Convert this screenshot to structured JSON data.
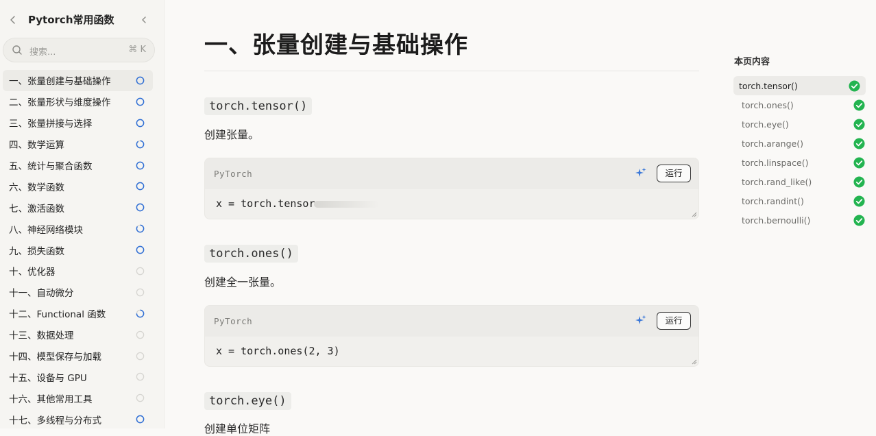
{
  "sidebar": {
    "title": "Pytorch常用函数",
    "search_placeholder": "搜索...",
    "search_shortcut": "⌘ K",
    "items": [
      {
        "label": "一、张量创建与基础操作",
        "progress": 1.0,
        "active": true
      },
      {
        "label": "二、张量形状与维度操作",
        "progress": 1.0
      },
      {
        "label": "三、张量拼接与选择",
        "progress": 1.0
      },
      {
        "label": "四、数学运算",
        "progress": 0.9
      },
      {
        "label": "五、统计与聚合函数",
        "progress": 1.0
      },
      {
        "label": "六、数学函数",
        "progress": 1.0
      },
      {
        "label": "七、激活函数",
        "progress": 1.0
      },
      {
        "label": "八、神经网络模块",
        "progress": 0.85
      },
      {
        "label": "九、损失函数",
        "progress": 1.0
      },
      {
        "label": "十、优化器",
        "progress": 0
      },
      {
        "label": "十一、自动微分",
        "progress": 0
      },
      {
        "label": "十二、Functional 函数",
        "progress": 0.75
      },
      {
        "label": "十三、数据处理",
        "progress": 0
      },
      {
        "label": "十四、模型保存与加载",
        "progress": 0
      },
      {
        "label": "十五、设备与 GPU",
        "progress": 0
      },
      {
        "label": "十六、其他常用工具",
        "progress": 0
      },
      {
        "label": "十七、多线程与分布式",
        "progress": 1.0
      }
    ]
  },
  "main": {
    "title": "一、张量创建与基础操作",
    "sections": [
      {
        "fn": "torch.tensor()",
        "desc": "创建张量。",
        "lang": "PyTorch",
        "run_label": "运行",
        "code": "x = torch.tensor"
      },
      {
        "fn": "torch.ones()",
        "desc": "创建全一张量。",
        "lang": "PyTorch",
        "run_label": "运行",
        "code": "x = torch.ones(2, 3)"
      },
      {
        "fn": "torch.eye()",
        "desc": "创建单位矩阵"
      }
    ]
  },
  "toc": {
    "title": "本页内容",
    "items": [
      {
        "label": "torch.tensor()",
        "active": true
      },
      {
        "label": "torch.ones()"
      },
      {
        "label": "torch.eye()"
      },
      {
        "label": "torch.arange()"
      },
      {
        "label": "torch.linspace()"
      },
      {
        "label": "torch.rand_like()"
      },
      {
        "label": "torch.randint()"
      },
      {
        "label": "torch.bernoulli()"
      }
    ]
  },
  "colors": {
    "accent": "#2f6fd6",
    "check": "#23b450",
    "ring_empty": "#d6d5d1"
  }
}
